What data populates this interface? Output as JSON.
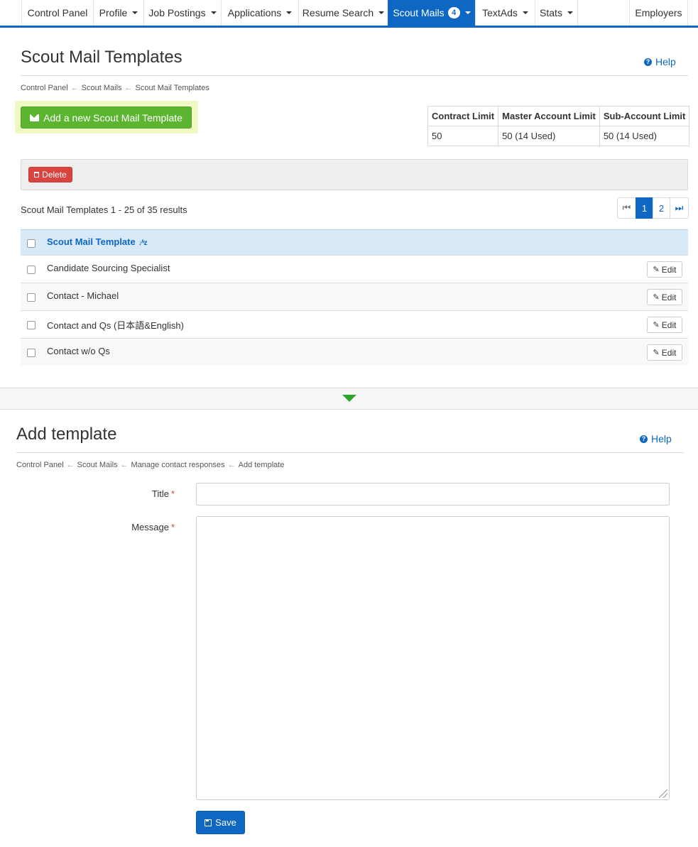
{
  "nav": {
    "control_panel": "Control Panel",
    "profile": "Profile",
    "job_postings": "Job Postings",
    "applications": "Applications",
    "resume_search": "Resume Search",
    "scout_mails": "Scout Mails",
    "scout_mails_badge": "4",
    "textads": "TextAds",
    "stats": "Stats",
    "employers": "Employers"
  },
  "list_section": {
    "title": "Scout Mail Templates",
    "help": "Help",
    "breadcrumb": [
      "Control Panel",
      "Scout Mails",
      "Scout Mail Templates"
    ],
    "breadcrumb_sep": "←",
    "add_button": "Add a new Scout Mail Template",
    "limits": {
      "headers": [
        "Contract Limit",
        "Master Account Limit",
        "Sub-Account Limit"
      ],
      "values": [
        "50",
        "50 (14 Used)",
        "50 (14 Used)"
      ]
    },
    "delete_button": "Delete",
    "result_text": "Scout Mail Templates 1 - 25 of 35 results",
    "pagination": {
      "first": "⏮",
      "pages": [
        "1",
        "2"
      ],
      "last": "⏭",
      "current": "1"
    },
    "column_header": "Scout Mail Template",
    "sort_icon": "↓ᴬz",
    "edit_label": "Edit",
    "rows": [
      "Candidate Sourcing Specialist",
      "Contact - Michael",
      "Contact and Qs (日本語&English)",
      "Contact w/o Qs"
    ]
  },
  "form_section": {
    "title": "Add template",
    "help": "Help",
    "breadcrumb": [
      "Control Panel",
      "Scout Mails",
      "Manage contact responses",
      "Add template"
    ],
    "breadcrumb_sep": "←",
    "title_label": "Title",
    "message_label": "Message",
    "required_mark": "*",
    "title_value": "",
    "message_value": "",
    "save_button": "Save"
  },
  "colors": {
    "primary": "#0e67c2",
    "success": "#5cb531",
    "danger": "#d9443e",
    "header_row": "#d8e9f8"
  }
}
